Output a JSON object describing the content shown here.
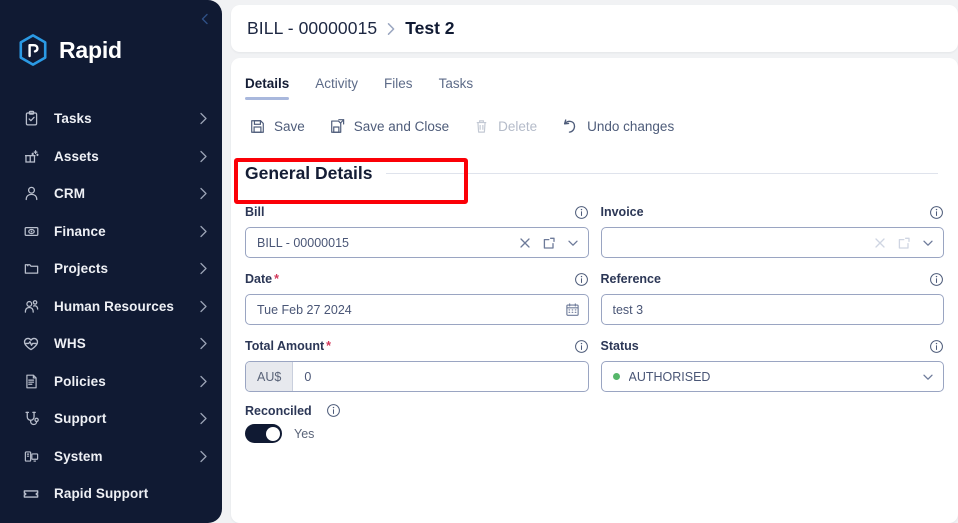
{
  "colors": {
    "sidebar_bg": "#101a33",
    "brand_blue": "#2b9ae4",
    "highlight_red": "#fb0007",
    "tab_underline": "#a9b8dd",
    "status_green": "#56b76a",
    "required_red": "#d2385a"
  },
  "sidebar": {
    "brand_name": "Rapid",
    "collapse_icon": "chevron-left-icon",
    "items": [
      {
        "label": "Tasks",
        "icon": "clipboard-check-icon",
        "chevron": true
      },
      {
        "label": "Assets",
        "icon": "assets-box-icon",
        "chevron": true
      },
      {
        "label": "CRM",
        "icon": "person-icon",
        "chevron": true
      },
      {
        "label": "Finance",
        "icon": "money-eye-icon",
        "chevron": true
      },
      {
        "label": "Projects",
        "icon": "folder-icon",
        "chevron": true
      },
      {
        "label": "Human Resources",
        "icon": "people-icon",
        "chevron": true
      },
      {
        "label": "WHS",
        "icon": "heart-pulse-icon",
        "chevron": true
      },
      {
        "label": "Policies",
        "icon": "document-icon",
        "chevron": true
      },
      {
        "label": "Support",
        "icon": "stethoscope-icon",
        "chevron": true
      },
      {
        "label": "System",
        "icon": "server-icon",
        "chevron": true
      },
      {
        "label": "Rapid Support",
        "icon": "ticket-icon",
        "chevron": false
      }
    ]
  },
  "breadcrumb": {
    "root": "BILL - 00000015",
    "separator_icon": "chevron-right-icon",
    "current": "Test 2"
  },
  "tabs": [
    {
      "label": "Details",
      "active": true
    },
    {
      "label": "Activity",
      "active": false
    },
    {
      "label": "Files",
      "active": false
    },
    {
      "label": "Tasks",
      "active": false
    }
  ],
  "toolbar": {
    "save_label": "Save",
    "save_icon": "floppy-disk-icon",
    "save_and_close_label": "Save and Close",
    "save_and_close_icon": "floppy-disk-arrow-icon",
    "delete_label": "Delete",
    "delete_icon": "trash-icon",
    "delete_disabled": true,
    "undo_label": "Undo changes",
    "undo_icon": "undo-arrow-icon",
    "highlight": "save-and-save-and-close"
  },
  "section": {
    "title": "General Details"
  },
  "fields": {
    "bill": {
      "label": "Bill",
      "value": "BILL - 00000015",
      "required": false,
      "info_icon": "info-icon",
      "icons": [
        "clear-x-icon",
        "open-external-icon",
        "chevron-down-icon"
      ]
    },
    "invoice": {
      "label": "Invoice",
      "value": "",
      "placeholder": "",
      "required": false,
      "info_icon": "info-icon",
      "icons": [
        "clear-x-icon",
        "open-external-icon",
        "chevron-down-icon"
      ]
    },
    "date": {
      "label": "Date",
      "value": "Tue Feb 27 2024",
      "required": true,
      "info_icon": "info-icon",
      "icons": [
        "calendar-icon"
      ]
    },
    "reference": {
      "label": "Reference",
      "value": "test 3",
      "required": false,
      "info_icon": "info-icon",
      "icons": []
    },
    "total_amount": {
      "label": "Total Amount",
      "prefix": "AU$",
      "value": "0",
      "required": true,
      "info_icon": "info-icon",
      "icons": []
    },
    "status": {
      "label": "Status",
      "value": "AUTHORISED",
      "required": false,
      "info_icon": "info-icon",
      "icons": [
        "chevron-down-icon"
      ],
      "dot_color": "#56b76a"
    },
    "reconciled": {
      "label": "Reconciled",
      "info_icon": "info-icon",
      "toggle_on": true,
      "toggle_text": "Yes"
    }
  }
}
